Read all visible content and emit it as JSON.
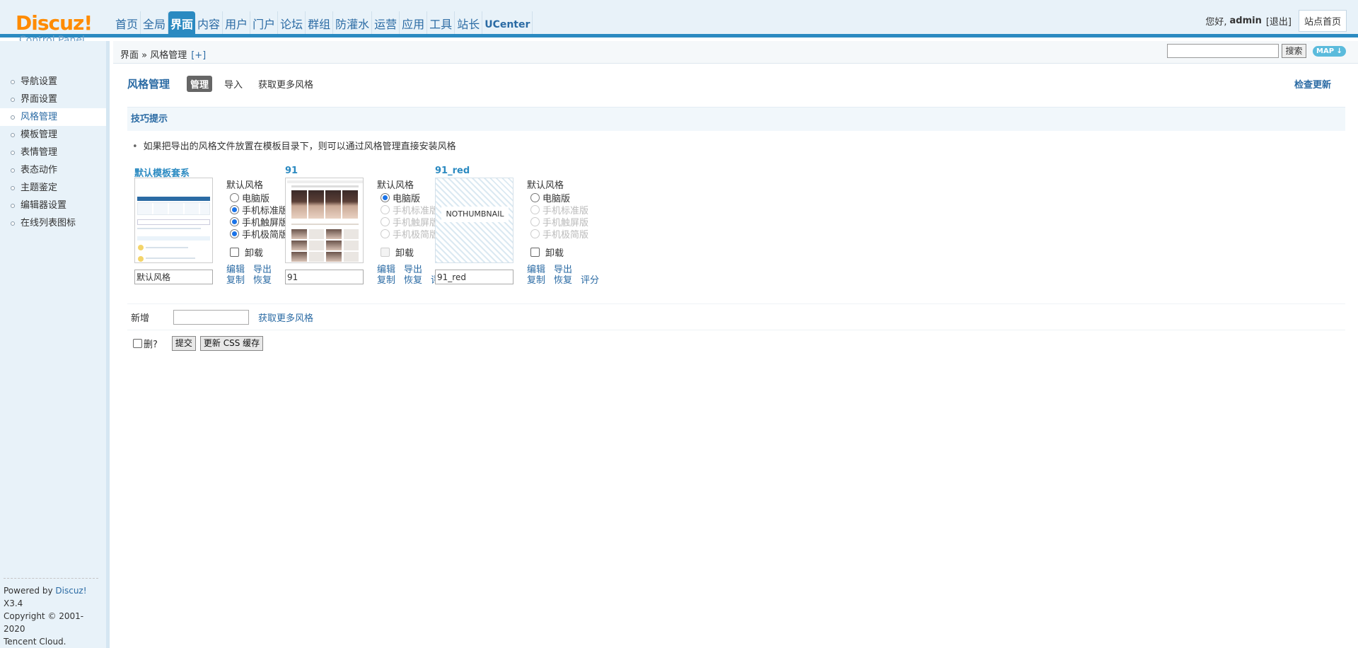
{
  "header": {
    "logo_text": "Discuz!",
    "logo_sub": "Control Panel",
    "nav": [
      "首页",
      "全局",
      "界面",
      "内容",
      "用户",
      "门户",
      "论坛",
      "群组",
      "防灌水",
      "运营",
      "应用",
      "工具",
      "站长",
      "UCenter"
    ],
    "active_nav": "界面",
    "greeting": "您好,",
    "username": "admin",
    "logout": "[退出]",
    "site_home": "站点首页"
  },
  "breadcrumb": {
    "path": "界面 » 风格管理",
    "add": "[+]",
    "search_button": "搜索",
    "map_button": "MAP ↓"
  },
  "sidebar": {
    "items": [
      "导航设置",
      "界面设置",
      "风格管理",
      "模板管理",
      "表情管理",
      "表态动作",
      "主题鉴定",
      "编辑器设置",
      "在线列表图标"
    ],
    "active_item": "风格管理",
    "footer": {
      "powered_prefix": "Powered by",
      "brand": "Discuz!",
      "version": "X3.4",
      "copyright": "Copyright © 2001-2020",
      "company": "Tencent Cloud."
    }
  },
  "main": {
    "title": "风格管理",
    "tabs": [
      "管理",
      "导入",
      "获取更多风格"
    ],
    "active_tab": "管理",
    "check_update": "检查更新",
    "tips_title": "技巧提示",
    "tip_text": "如果把导出的风格文件放置在模板目录下，则可以通过风格管理直接安装风格",
    "styles": [
      {
        "name": "默认模板套系",
        "thumb": "default-screenshot",
        "input_value": "默认风格",
        "default_label": "默认风格",
        "options": [
          {
            "label": "电脑版",
            "checked": false,
            "disabled": false
          },
          {
            "label": "手机标准版",
            "checked": true,
            "disabled": false
          },
          {
            "label": "手机触屏版",
            "checked": true,
            "disabled": false
          },
          {
            "label": "手机极简版",
            "checked": true,
            "disabled": false
          }
        ],
        "uninstall": "卸载",
        "uninstall_disabled": false,
        "actions": [
          [
            "编辑",
            "导出"
          ],
          [
            "复制",
            "恢复"
          ]
        ]
      },
      {
        "name": "91",
        "thumb": "photo-screenshot",
        "input_value": "91",
        "default_label": "默认风格",
        "options": [
          {
            "label": "电脑版",
            "checked": true,
            "disabled": false
          },
          {
            "label": "手机标准版",
            "checked": false,
            "disabled": true
          },
          {
            "label": "手机触屏版",
            "checked": false,
            "disabled": true
          },
          {
            "label": "手机极简版",
            "checked": false,
            "disabled": true
          }
        ],
        "uninstall": "卸载",
        "uninstall_disabled": true,
        "actions": [
          [
            "编辑",
            "导出"
          ],
          [
            "复制",
            "恢复",
            "评分"
          ]
        ]
      },
      {
        "name": "91_red",
        "thumb": "nothumbnail",
        "thumb_label": "NOTHUMBNAIL",
        "input_value": "91_red",
        "default_label": "默认风格",
        "options": [
          {
            "label": "电脑版",
            "checked": false,
            "disabled": false
          },
          {
            "label": "手机标准版",
            "checked": false,
            "disabled": true
          },
          {
            "label": "手机触屏版",
            "checked": false,
            "disabled": true
          },
          {
            "label": "手机极简版",
            "checked": false,
            "disabled": true
          }
        ],
        "uninstall": "卸载",
        "uninstall_disabled": false,
        "actions": [
          [
            "编辑",
            "导出"
          ],
          [
            "复制",
            "恢复",
            "评分"
          ]
        ]
      }
    ],
    "add_label": "新增",
    "add_more": "获取更多风格",
    "delete_label": "删?",
    "submit_button": "提交",
    "css_cache_button": "更新 CSS 缓存"
  },
  "colors": {
    "brand_orange": "#ff8b00",
    "accent_blue": "#2b8ac1",
    "link_blue": "#2b6ba4",
    "sidebar_bg": "#e8f2f9"
  }
}
